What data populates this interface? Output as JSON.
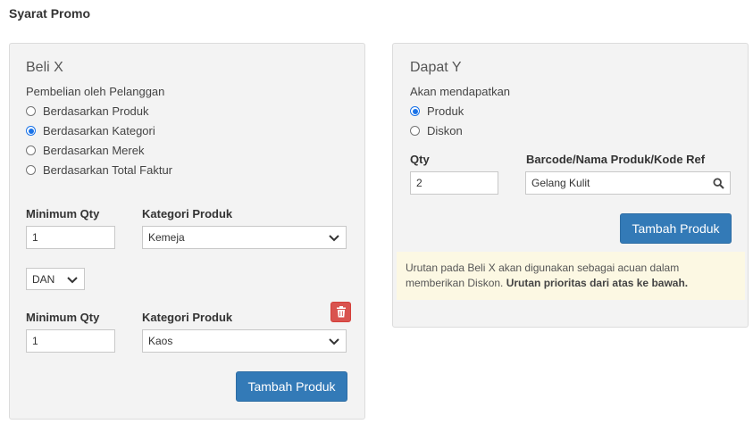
{
  "section_title": "Syarat Promo",
  "beli_x": {
    "heading": "Beli X",
    "purchase_label": "Pembelian oleh Pelanggan",
    "options": [
      {
        "label": "Berdasarkan Produk",
        "checked": false
      },
      {
        "label": "Berdasarkan Kategori",
        "checked": true
      },
      {
        "label": "Berdasarkan Merek",
        "checked": false
      },
      {
        "label": "Berdasarkan Total Faktur",
        "checked": false
      }
    ],
    "rows": [
      {
        "qty_label": "Minimum Qty",
        "qty_value": "1",
        "category_label": "Kategori Produk",
        "category_value": "Kemeja"
      },
      {
        "qty_label": "Minimum Qty",
        "qty_value": "1",
        "category_label": "Kategori Produk",
        "category_value": "Kaos"
      }
    ],
    "connector": "DAN",
    "add_button": "Tambah Produk"
  },
  "dapat_y": {
    "heading": "Dapat Y",
    "receive_label": "Akan mendapatkan",
    "options": [
      {
        "label": "Produk",
        "checked": true
      },
      {
        "label": "Diskon",
        "checked": false
      }
    ],
    "qty_label": "Qty",
    "qty_value": "2",
    "product_label": "Barcode/Nama Produk/Kode Ref",
    "product_value": "Gelang Kulit",
    "add_button": "Tambah Produk"
  },
  "note": {
    "text": "Urutan pada Beli X akan digunakan sebagai acuan dalam memberikan Diskon.",
    "bold": "Urutan prioritas dari atas ke bawah."
  },
  "colors": {
    "primary": "#337ab7",
    "danger": "#d9534f",
    "radio_checked": "#1a73e8",
    "note_bg": "#fcf8e3",
    "panel_bg": "#f3f3f3"
  },
  "icons": {
    "search": "search-icon",
    "delete": "trash-icon",
    "dropdown": "chevron-down-icon"
  }
}
